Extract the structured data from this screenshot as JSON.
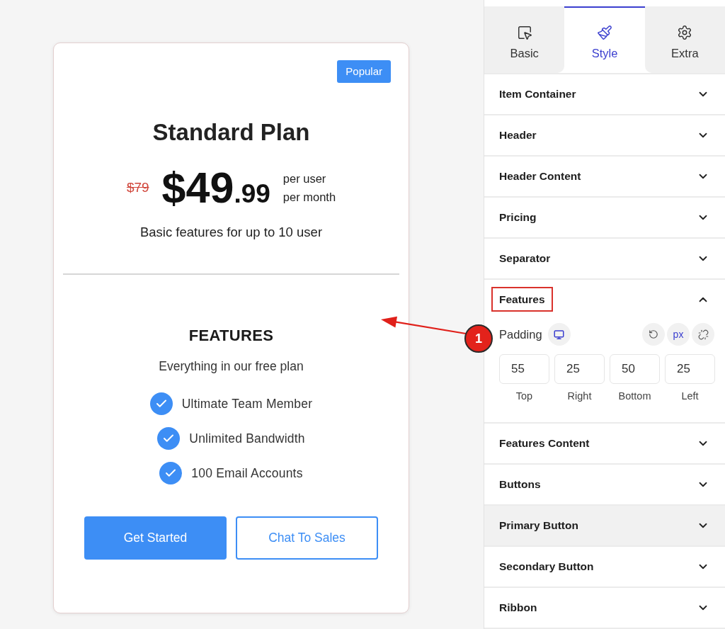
{
  "card": {
    "badge": "Popular",
    "title": "Standard Plan",
    "price": {
      "old": "$79",
      "whole": "$49",
      "fraction": ".99",
      "period": [
        "per user",
        "per month"
      ]
    },
    "description": "Basic features for up to 10 user",
    "features": {
      "title": "FEATURES",
      "subtitle": "Everything in our free plan",
      "items": [
        "Ultimate Team Member",
        "Unlimited Bandwidth",
        "100 Email Accounts"
      ]
    },
    "buttons": [
      {
        "label": "Get Started",
        "kind": "primary"
      },
      {
        "label": "Chat To Sales",
        "kind": "secondary"
      }
    ]
  },
  "callout": {
    "number": "1"
  },
  "panel": {
    "tabs": [
      {
        "label": "Basic",
        "selected": false
      },
      {
        "label": "Style",
        "selected": true
      },
      {
        "label": "Extra",
        "selected": false
      }
    ],
    "sections": [
      {
        "label": "Item Container",
        "expanded": false,
        "hovered": false,
        "outlined": false
      },
      {
        "label": "Header",
        "expanded": false,
        "hovered": false,
        "outlined": false
      },
      {
        "label": "Header Content",
        "expanded": false,
        "hovered": false,
        "outlined": false
      },
      {
        "label": "Pricing",
        "expanded": false,
        "hovered": false,
        "outlined": false
      },
      {
        "label": "Separator",
        "expanded": false,
        "hovered": false,
        "outlined": false
      },
      {
        "label": "Features",
        "expanded": true,
        "hovered": false,
        "outlined": true,
        "padding": {
          "label": "Padding",
          "unit": "px",
          "fields": [
            {
              "value": "55",
              "label": "Top"
            },
            {
              "value": "25",
              "label": "Right"
            },
            {
              "value": "50",
              "label": "Bottom"
            },
            {
              "value": "25",
              "label": "Left"
            }
          ]
        }
      },
      {
        "label": "Features Content",
        "expanded": false,
        "hovered": false,
        "outlined": false
      },
      {
        "label": "Buttons",
        "expanded": false,
        "hovered": false,
        "outlined": false
      },
      {
        "label": "Primary Button",
        "expanded": false,
        "hovered": true,
        "outlined": false
      },
      {
        "label": "Secondary Button",
        "expanded": false,
        "hovered": false,
        "outlined": false
      },
      {
        "label": "Ribbon",
        "expanded": false,
        "hovered": false,
        "outlined": false
      }
    ]
  }
}
